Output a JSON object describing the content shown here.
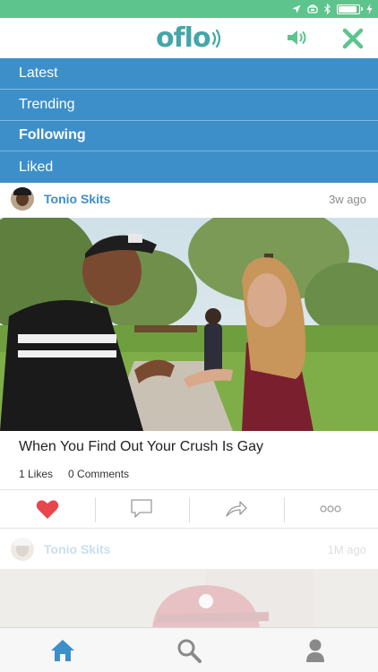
{
  "app": {
    "logo_text": "oflo",
    "brand_color": "#44a6a8",
    "accent_color": "#3d8fc9",
    "status_bar_color": "#5ec48d"
  },
  "status_bar": {
    "icons": [
      "location-icon",
      "alarm-icon",
      "bluetooth-icon",
      "battery-icon",
      "charging-icon"
    ],
    "battery_level": 0.9
  },
  "top_bar": {
    "icons": [
      "sound-icon",
      "close-icon"
    ]
  },
  "menu": {
    "items": [
      {
        "label": "Latest",
        "active": false
      },
      {
        "label": "Trending",
        "active": false
      },
      {
        "label": "Following",
        "active": true
      },
      {
        "label": "Liked",
        "active": false
      }
    ]
  },
  "feed": {
    "posts": [
      {
        "author": "Tonio Skits",
        "time": "3w ago",
        "title": "When You Find Out Your Crush Is Gay",
        "likes": "1 Likes",
        "comments": "0 Comments",
        "liked": true
      },
      {
        "author": "Tonio Skits",
        "time": "1M ago"
      }
    ]
  },
  "actions": [
    "like-icon",
    "comment-icon",
    "share-icon",
    "more-icon"
  ],
  "tabs": [
    {
      "name": "home",
      "icon": "home-icon",
      "active": true
    },
    {
      "name": "search",
      "icon": "search-icon",
      "active": false
    },
    {
      "name": "profile",
      "icon": "profile-icon",
      "active": false
    }
  ]
}
